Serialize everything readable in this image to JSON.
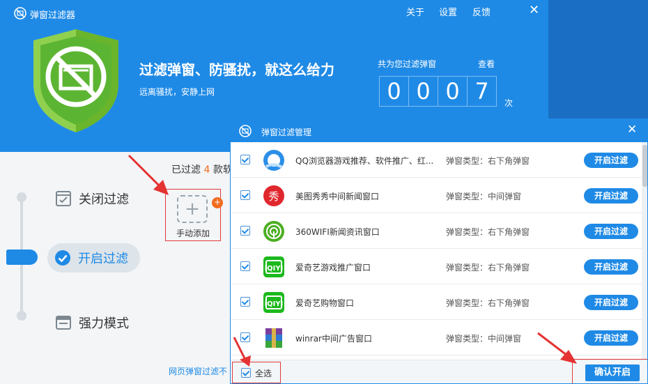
{
  "app": {
    "title": "弹窗过滤器",
    "links": [
      "关于",
      "设置",
      "反馈"
    ],
    "slogan": "过滤弹窗、防骚扰，就这么给力",
    "subslogan": "远离骚扰，安静上网",
    "count_label": "共为您过滤弹窗",
    "view_link": "查看",
    "count_digits": [
      "0",
      "0",
      "0",
      "7"
    ],
    "count_unit": "次"
  },
  "nav": {
    "off": "关闭过滤",
    "on": "开启过滤",
    "strong": "强力模式"
  },
  "stats": {
    "prefix": "已过滤",
    "count": "4",
    "suffix": "款软"
  },
  "add": {
    "label": "手动添加",
    "badge": "+"
  },
  "web_link": "网页弹窗过滤不",
  "dialog": {
    "title": "弹窗过滤管理",
    "select_all": "全选",
    "confirm": "确认开启",
    "rows": [
      {
        "name": "QQ浏览器游戏推荐、软件推广、红...",
        "type": "弹窗类型：右下角弹窗",
        "button": "开启过滤",
        "icon": "qq-browser-icon",
        "color": "#2b8fe8"
      },
      {
        "name": "美图秀秀中间新闻窗口",
        "type": "弹窗类型：中间弹窗",
        "button": "开启过滤",
        "icon": "meitu-icon",
        "color": "#e0272d"
      },
      {
        "name": "360WIFI新闻资讯窗口",
        "type": "弹窗类型：右下角弹窗",
        "button": "开启过滤",
        "icon": "wifi360-icon",
        "color": "#4caf24"
      },
      {
        "name": "爱奇艺游戏推广窗口",
        "type": "弹窗类型：右下角弹窗",
        "button": "开启过滤",
        "icon": "iqiyi-icon",
        "color": "#1cb91c"
      },
      {
        "name": "爱奇艺购物窗口",
        "type": "弹窗类型：右下角弹窗",
        "button": "开启过滤",
        "icon": "iqiyi-icon",
        "color": "#1cb91c"
      },
      {
        "name": "winrar中间广告窗口",
        "type": "弹窗类型：中间弹窗",
        "button": "开启过滤",
        "icon": "winrar-icon",
        "color": "#7a3f9c"
      }
    ]
  }
}
